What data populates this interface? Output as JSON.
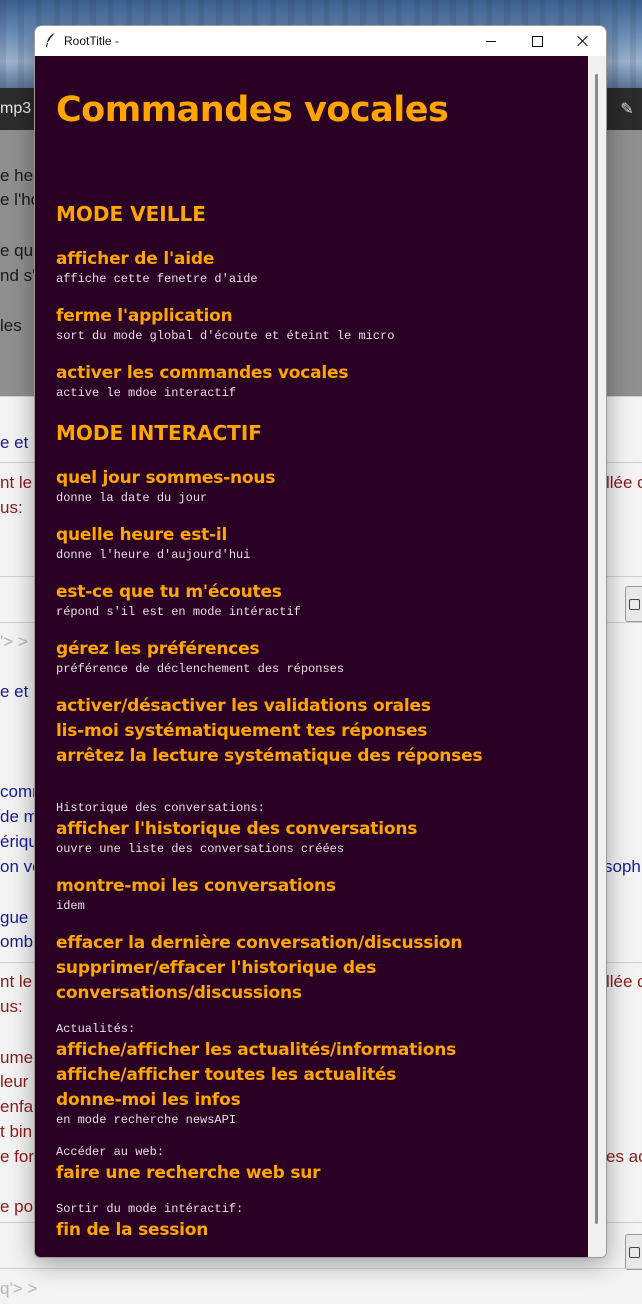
{
  "window": {
    "title": "RootTitle -"
  },
  "background_app": {
    "tab_label": "mp3",
    "lines": [
      "e heu",
      "e l'ho",
      "e que",
      "nd s'i",
      "les",
      "e et",
      "nt le",
      "us:",
      "e et",
      "comm",
      "de m",
      "ériqu",
      "on ve",
      "gue",
      "ombr",
      "nt le",
      "us:",
      "umen",
      "leur",
      "enfa",
      "t bin",
      "e for",
      "e po",
      "llée c",
      "soph",
      "llée c",
      "es ac"
    ],
    "prompts": [
      "'> >",
      "q'> >"
    ]
  },
  "help": {
    "title": "Commandes vocales",
    "veille_header": "MODE VEILLE",
    "veille": [
      {
        "cmd": "afficher de l'aide",
        "desc": "affiche cette fenetre d'aide"
      },
      {
        "cmd": "ferme l'application",
        "desc": "sort du mode global d'écoute et éteint le micro"
      },
      {
        "cmd": "activer les commandes vocales",
        "desc": "active le mdoe interactif"
      }
    ],
    "interactif_header": "MODE INTERACTIF",
    "interactif": [
      {
        "cmd": "quel jour sommes-nous",
        "desc": "donne la date du jour"
      },
      {
        "cmd": "quelle heure est-il",
        "desc": "donne l'heure d'aujourd'hui"
      },
      {
        "cmd": "est-ce que tu m'écoutes",
        "desc": "répond s'il est en mode intéractif"
      },
      {
        "cmd": "gérez les préférences",
        "desc": "préférence de déclenchement des réponses"
      }
    ],
    "validation_cmds": [
      "activer/désactiver les validations orales",
      "lis-moi systématiquement tes réponses",
      "arrêtez la lecture systématique des réponses"
    ],
    "historique_label": "Historique des conversations:",
    "historique": [
      {
        "cmd": "afficher l'historique des conversations",
        "desc": "ouvre une liste des conversations créées"
      },
      {
        "cmd": "montre-moi les conversations",
        "desc": "idem"
      }
    ],
    "effacer_cmds": [
      "effacer la dernière conversation/discussion",
      "supprimer/effacer l'historique des",
      "conversations/discussions"
    ],
    "actualites_label": "Actualités:",
    "actualites_cmds": [
      "affiche/afficher les actualités/informations",
      "affiche/afficher toutes les actualités",
      "donne-moi les infos"
    ],
    "actualites_desc": "en mode recherche newsAPI",
    "web_label": "Accéder au web:",
    "web_cmd": "faire une recherche web sur",
    "sortir_label": "Sortir du mode intéractif:",
    "sortir_cmd": "fin de la session"
  },
  "colors": {
    "background": "#2a0124",
    "accent": "#ffa500",
    "description": "#e9dde6"
  },
  "icons": {
    "app_icon": "feather-icon",
    "minimize": "minimize-icon",
    "maximize": "maximize-icon",
    "close": "close-icon"
  }
}
